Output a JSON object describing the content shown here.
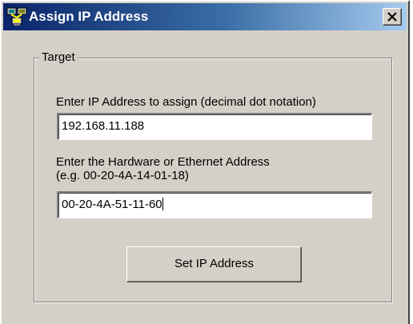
{
  "window": {
    "title": "Assign IP Address",
    "close_glyph": "✕"
  },
  "group": {
    "legend": "Target"
  },
  "ip_field": {
    "label": "Enter IP Address to assign (decimal dot notation)",
    "value": "192.168.11.188"
  },
  "hw_field": {
    "label_line1": "Enter the Hardware or Ethernet Address",
    "label_line2": "(e.g. 00-20-4A-14-01-18)",
    "value": "00-20-4A-51-11-60"
  },
  "actions": {
    "set_label": "Set IP Address"
  },
  "icons": {
    "app": "network-computers-icon",
    "close": "close-icon"
  }
}
